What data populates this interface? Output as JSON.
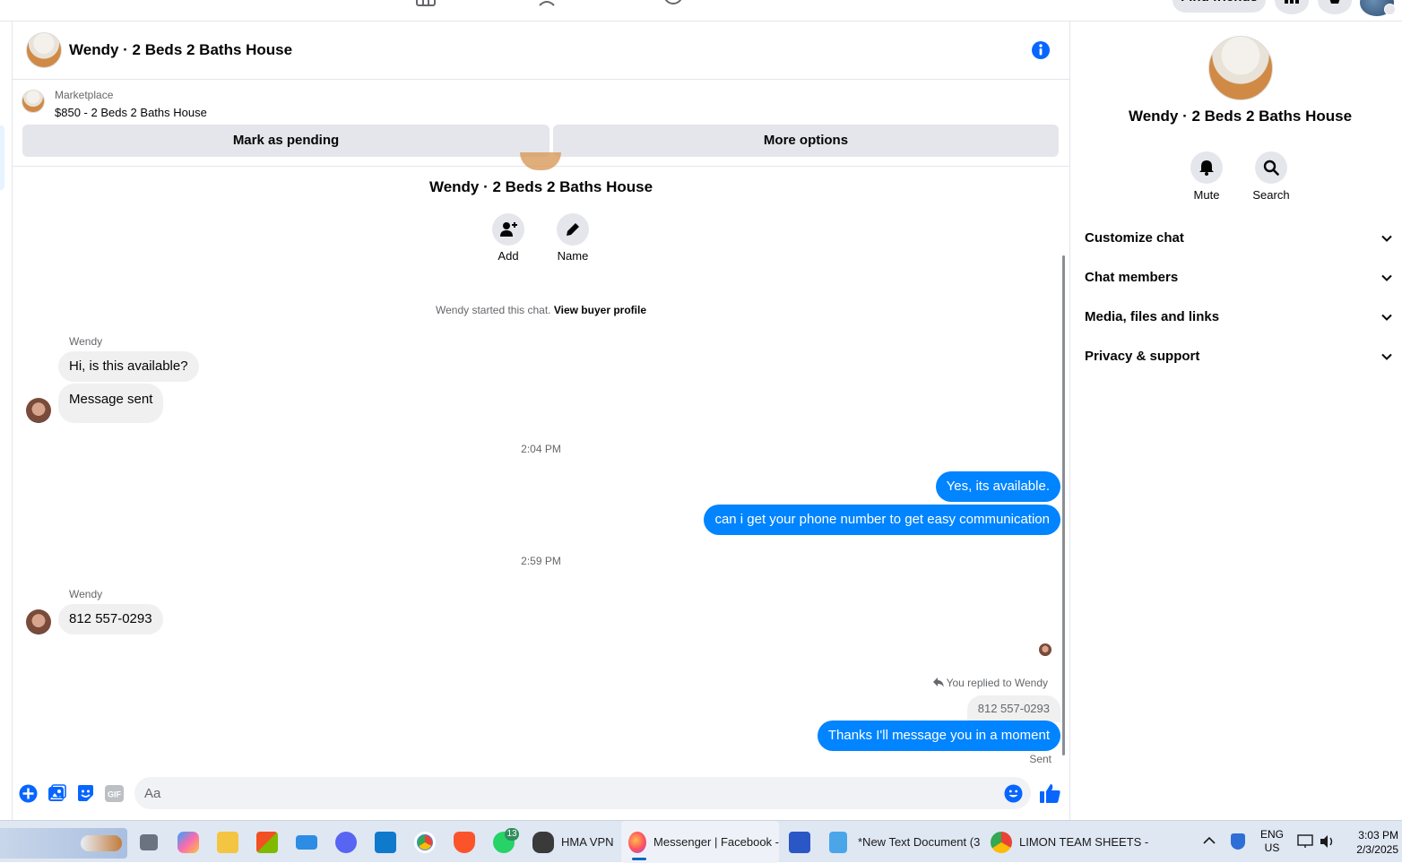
{
  "topnav": {
    "find_friends_label": "Find friends"
  },
  "chat_header": {
    "title": "Wendy · 2 Beds 2 Baths House"
  },
  "marketplace": {
    "label": "Marketplace",
    "listing": "$850 - 2 Beds 2 Baths House",
    "mark_pending_label": "Mark as pending",
    "more_options_label": "More options"
  },
  "chat_intro": {
    "title": "Wendy · 2 Beds 2 Baths House",
    "add_label": "Add",
    "name_label": "Name",
    "started_text": "Wendy started this chat.",
    "view_profile_link": "View buyer profile"
  },
  "messages": {
    "sender_1": "Wendy",
    "in_1": "Hi, is this available?",
    "in_2": "Message sent",
    "time_1": "2:04 PM",
    "out_1": "Yes, its available.",
    "out_2": "can i get your phone number to get easy communication",
    "time_2": "2:59 PM",
    "sender_2": "Wendy",
    "in_3": "812 557-0293",
    "reply_note": "You replied to Wendy",
    "reply_quote": "812 557-0293",
    "out_3": "Thanks I'll message you in a moment",
    "status": "Sent"
  },
  "composer": {
    "placeholder": "Aa"
  },
  "right_panel": {
    "title": "Wendy · 2 Beds 2 Baths House",
    "mute_label": "Mute",
    "search_label": "Search",
    "sections": [
      "Customize chat",
      "Chat members",
      "Media, files and links",
      "Privacy & support"
    ]
  },
  "taskbar": {
    "whatsapp_badge": "13",
    "hma_label": "HMA VPN",
    "firefox_label": "Messenger | Facebook -",
    "notepad_label": "*New Text Document (3",
    "chrome_label": "LIMON TEAM SHEETS -",
    "lang_line1": "ENG",
    "lang_line2": "US",
    "time": "3:03 PM",
    "date": "2/3/2025"
  },
  "colors": {
    "messenger_blue": "#0084ff",
    "fb_blue": "#0866ff",
    "bubble_grey": "#f0f0f0",
    "button_grey": "#e4e6eb"
  },
  "icons": [
    "info-icon",
    "user-plus-icon",
    "pencil-icon",
    "bell-icon",
    "search-icon",
    "chevron-down-icon",
    "plus-circle-icon",
    "image-icon",
    "sticker-icon",
    "gif-icon",
    "emoji-icon",
    "thumbs-up-icon",
    "reply-icon"
  ]
}
